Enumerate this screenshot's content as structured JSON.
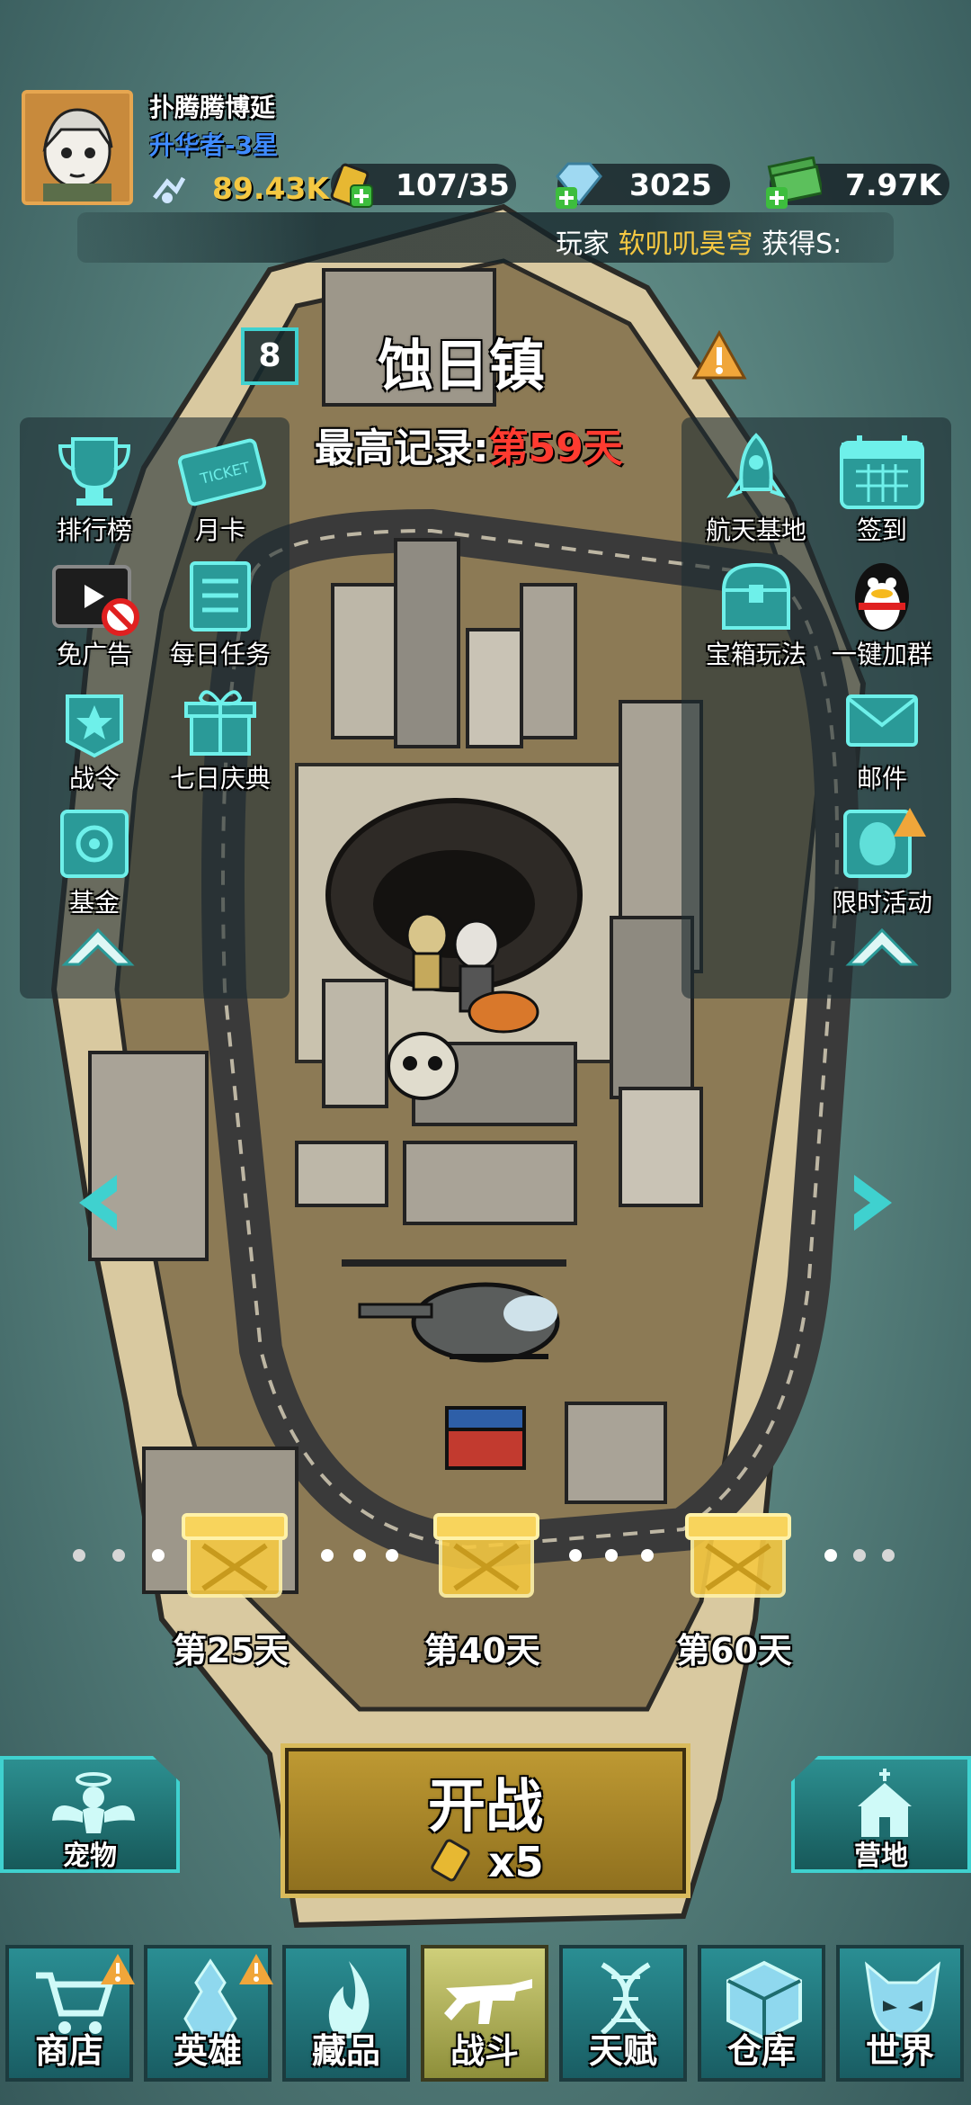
{
  "player": {
    "name": "扑腾腾博延",
    "rank": "升华者-3星"
  },
  "resources": {
    "power": "89.43K",
    "energy": "107/35",
    "diamonds": "3025",
    "cash": "7.97K"
  },
  "ticker": {
    "prefix": "玩家",
    "player": "软叽叽昊穹",
    "suffix": "获得S:"
  },
  "stage": {
    "level": "8",
    "name": "蚀日镇",
    "best_label": "最高记录:",
    "best_value": "第59天"
  },
  "left_menu": [
    {
      "label": "排行榜",
      "icon": "trophy-icon"
    },
    {
      "label": "月卡",
      "icon": "ticket-icon"
    },
    {
      "label": "免广告",
      "icon": "no-ads-icon"
    },
    {
      "label": "每日任务",
      "icon": "task-icon"
    },
    {
      "label": "战令",
      "icon": "battle-pass-icon"
    },
    {
      "label": "七日庆典",
      "icon": "gift-icon"
    },
    {
      "label": "基金",
      "icon": "safe-icon"
    }
  ],
  "right_menu": [
    {
      "label": "航天基地",
      "icon": "rocket-icon"
    },
    {
      "label": "签到",
      "icon": "calendar-icon"
    },
    {
      "label": "宝箱玩法",
      "icon": "chest-icon"
    },
    {
      "label": "一键加群",
      "icon": "qq-penguin-icon"
    },
    {
      "label": "邮件",
      "icon": "mail-icon"
    },
    {
      "label": "限时活动",
      "icon": "limited-event-icon"
    }
  ],
  "chests": [
    {
      "label": "第25天"
    },
    {
      "label": "第40天"
    },
    {
      "label": "第60天"
    }
  ],
  "battle": {
    "label": "开战",
    "cost": "x5"
  },
  "side_buttons": {
    "pet": "宠物",
    "camp": "营地"
  },
  "nav": [
    {
      "label": "商店",
      "icon": "cart-icon"
    },
    {
      "label": "英雄",
      "icon": "hero-icon"
    },
    {
      "label": "藏品",
      "icon": "flame-icon"
    },
    {
      "label": "战斗",
      "icon": "rifle-icon"
    },
    {
      "label": "天赋",
      "icon": "dna-icon"
    },
    {
      "label": "仓库",
      "icon": "crate-icon"
    },
    {
      "label": "世界",
      "icon": "demon-icon"
    }
  ],
  "colors": {
    "accent": "#3fd1cf",
    "gold": "#f5c842",
    "danger": "#ff3b30",
    "battle": "#b38f2b"
  }
}
